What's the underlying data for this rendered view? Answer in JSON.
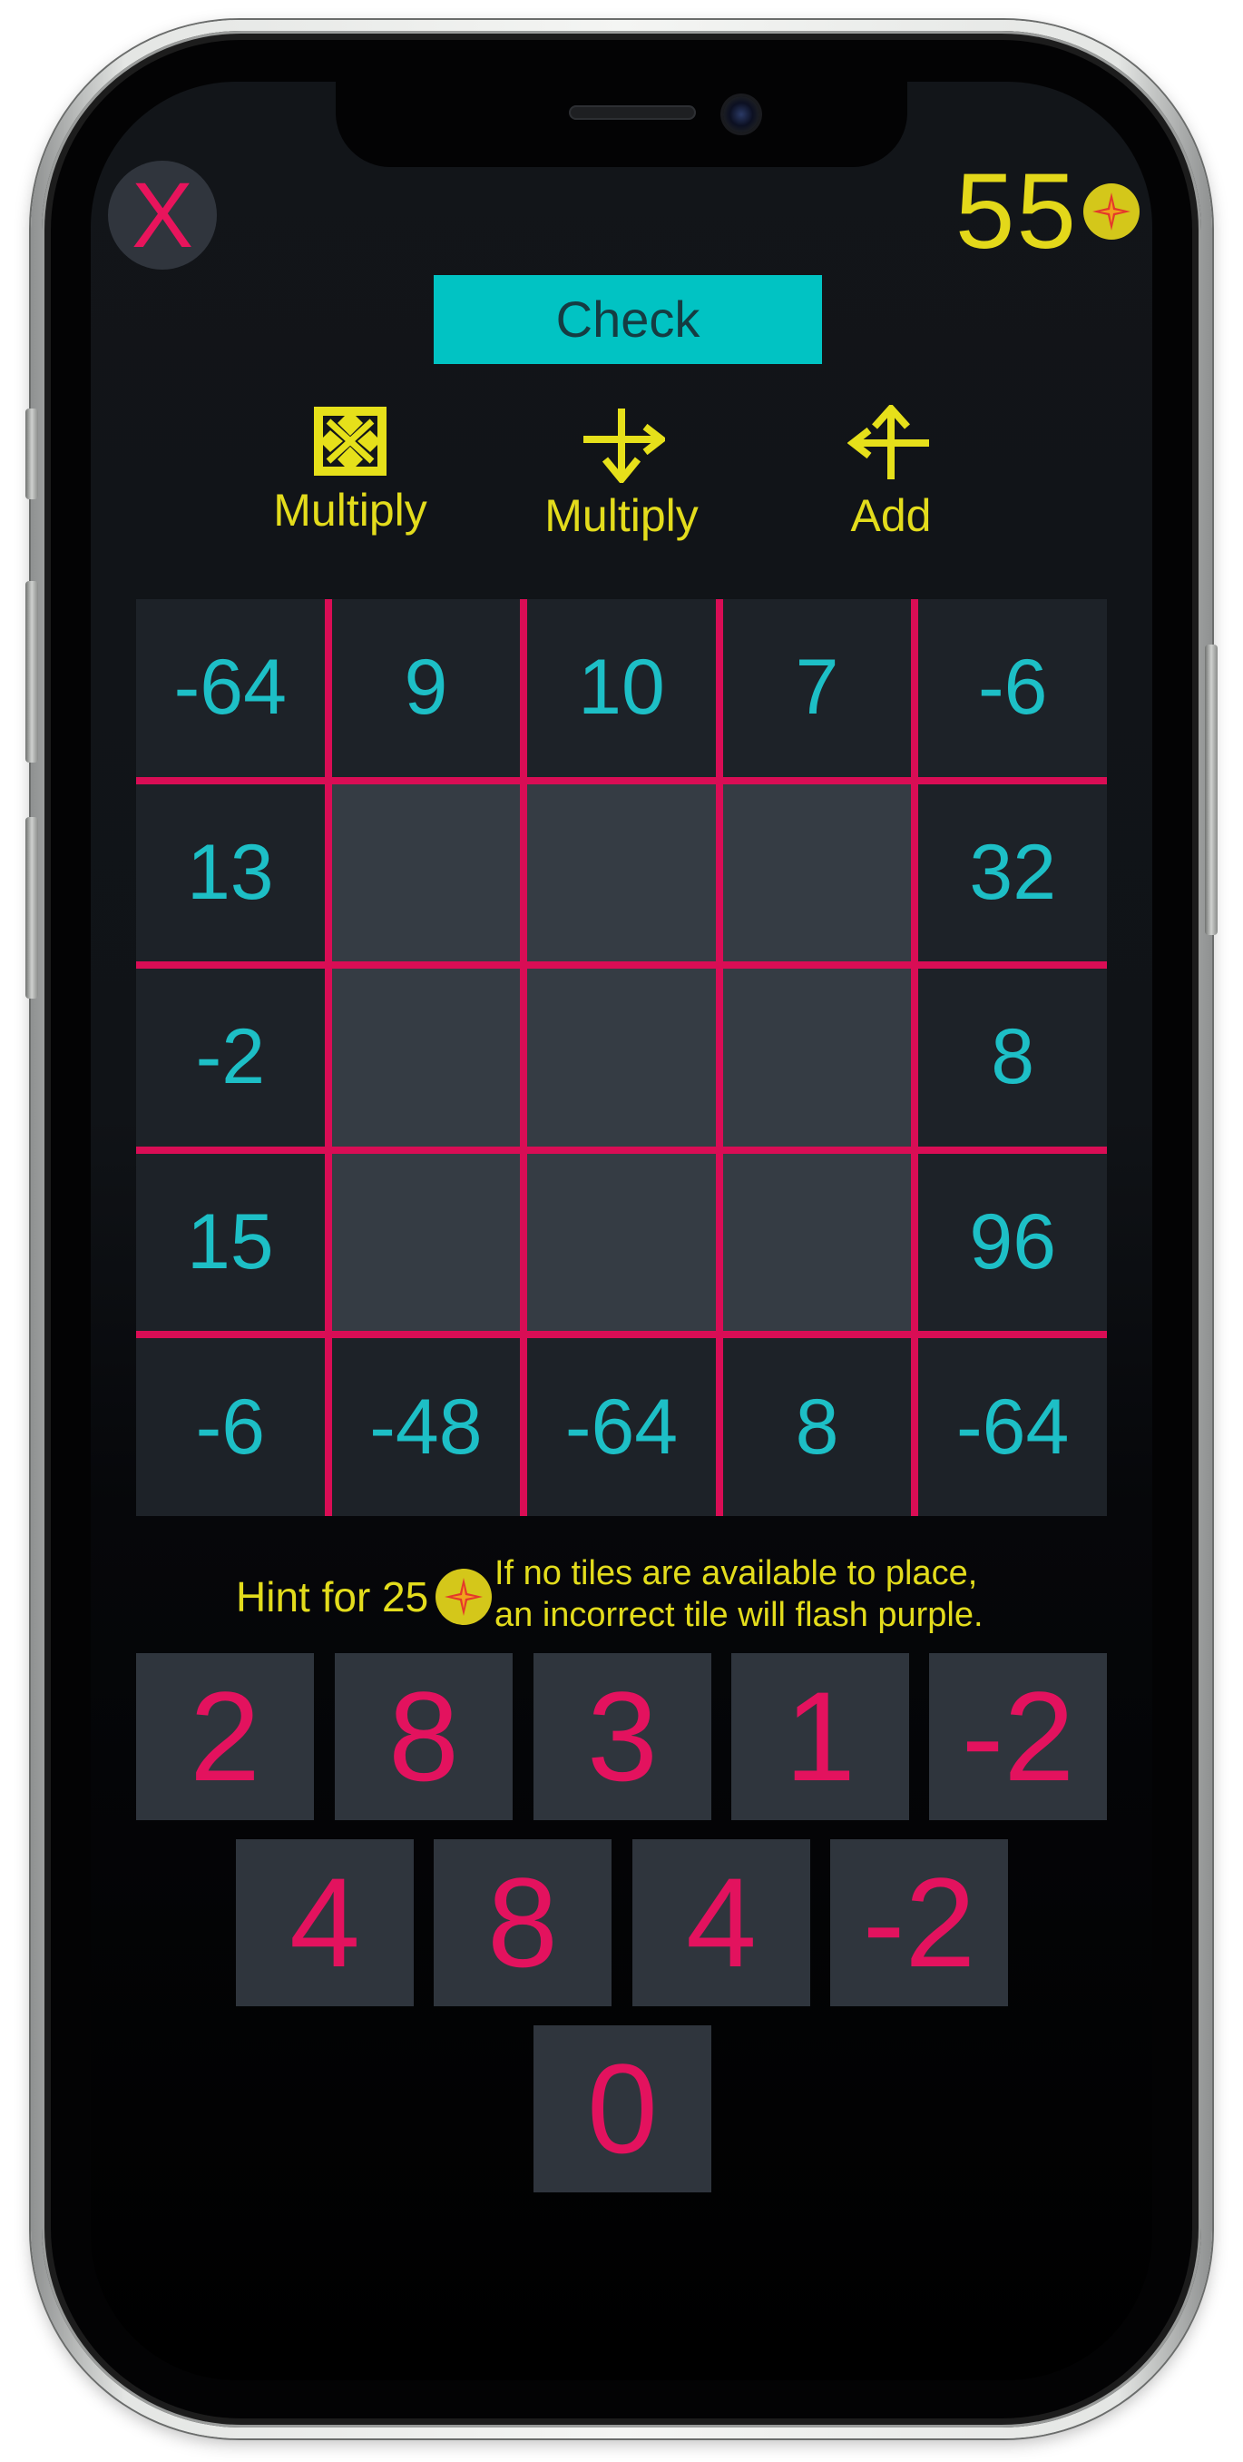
{
  "game": {
    "close_label": "X",
    "coins": "55",
    "check_label": "Check",
    "operations": [
      {
        "icon": "diagonal-arrows-icon",
        "label": "Multiply"
      },
      {
        "icon": "down-arrows-icon",
        "label": "Multiply"
      },
      {
        "icon": "up-arrows-icon",
        "label": "Add"
      }
    ],
    "grid": [
      [
        "-64",
        "9",
        "10",
        "7",
        "-6"
      ],
      [
        "13",
        "",
        "",
        "",
        "32"
      ],
      [
        "-2",
        "",
        "",
        "",
        "8"
      ],
      [
        "15",
        "",
        "",
        "",
        "96"
      ],
      [
        "-6",
        "-48",
        "-64",
        "8",
        "-64"
      ]
    ],
    "hint": {
      "label": "Hint for 25",
      "note_line1": "If no tiles are available to place,",
      "note_line2": "an incorrect tile will flash purple."
    },
    "tiles": {
      "row1": [
        "2",
        "8",
        "3",
        "1",
        "-2"
      ],
      "row2": [
        "4",
        "8",
        "4",
        "-2"
      ],
      "row3": [
        "0"
      ]
    },
    "colors": {
      "accent_yellow": "#e3dc1c",
      "accent_teal": "#1dbfc6",
      "accent_pink": "#e3125e",
      "check_button": "#01c3c3"
    }
  }
}
